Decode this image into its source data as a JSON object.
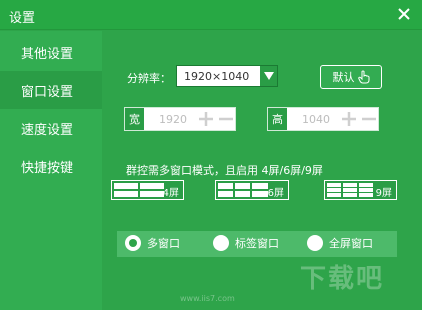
{
  "window": {
    "title": "设置",
    "close_icon": "close-icon"
  },
  "sidebar": {
    "items": [
      {
        "label": "其他设置"
      },
      {
        "label": "窗口设置"
      },
      {
        "label": "速度设置"
      },
      {
        "label": "快捷按键"
      }
    ],
    "active_index": 1
  },
  "resolution": {
    "label": "分辨率：",
    "value": "1920×1040",
    "dropdown_icon": "dropdown-arrow-icon"
  },
  "default_button": {
    "label": "默认",
    "icon": "hand-pointer-icon"
  },
  "width": {
    "tag": "宽",
    "value": "1920"
  },
  "height": {
    "tag": "高",
    "value": "1040"
  },
  "mode_note": "群控需多窗口模式，且启用 4屏/6屏/9屏",
  "screen_buttons": [
    {
      "label": "4屏"
    },
    {
      "label": "6屏"
    },
    {
      "label": "9屏"
    }
  ],
  "window_modes": {
    "options": [
      {
        "label": "多窗口",
        "selected": true
      },
      {
        "label": "标签窗口",
        "selected": false
      },
      {
        "label": "全屏窗口",
        "selected": false
      }
    ]
  },
  "watermark": {
    "text": "下载吧",
    "url": "www.iis7.com"
  },
  "colors": {
    "accent": "#2ea44a",
    "sidebar_active": "#2a9d46"
  }
}
